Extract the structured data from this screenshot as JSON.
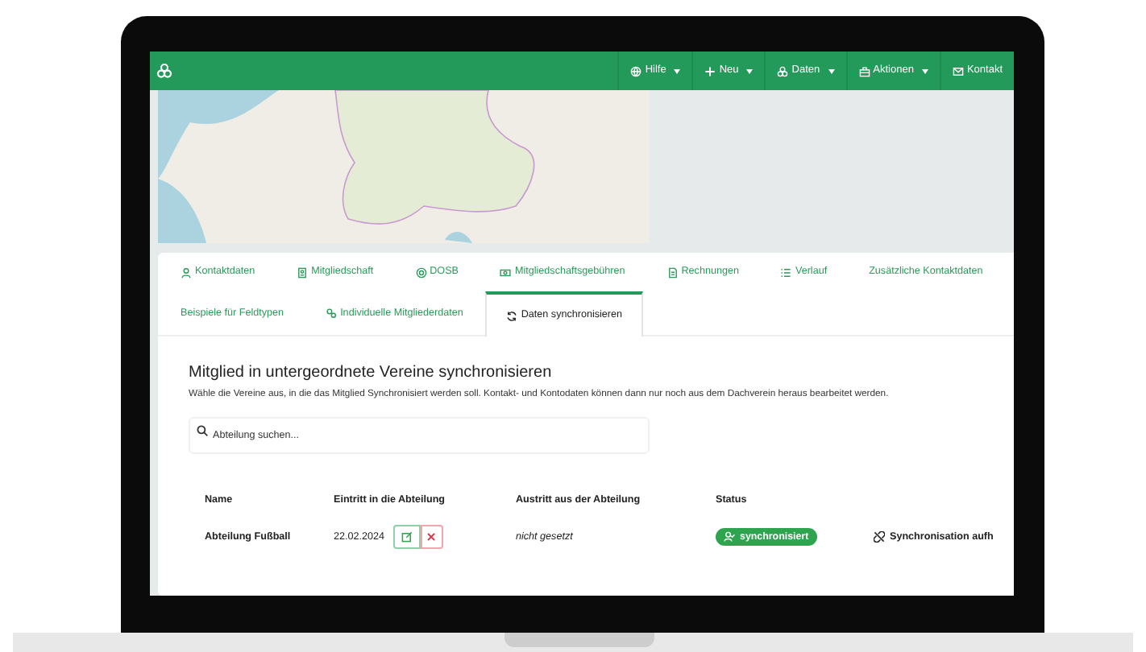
{
  "navbar": {
    "items": [
      {
        "label": "Hilfe"
      },
      {
        "label": "Neu"
      },
      {
        "label": "Daten"
      },
      {
        "label": "Aktionen"
      },
      {
        "label": "Kontakt"
      }
    ]
  },
  "tabs": [
    {
      "label": "Kontaktdaten",
      "selected": false
    },
    {
      "label": "Mitgliedschaft",
      "selected": false
    },
    {
      "label": "DOSB",
      "selected": false
    },
    {
      "label": "Mitgliedschaftsgebühren",
      "selected": false
    },
    {
      "label": "Rechnungen",
      "selected": false
    },
    {
      "label": "Verlauf",
      "selected": false
    },
    {
      "label": "Zusätzliche Kontaktdaten",
      "selected": false
    },
    {
      "label": "Beispiele für Feldtypen",
      "selected": false
    },
    {
      "label": "Individuelle Mitgliederdaten",
      "selected": false
    },
    {
      "label": "Daten synchronisieren",
      "selected": true
    }
  ],
  "section": {
    "title": "Mitglied in untergeordnete Vereine synchronisieren",
    "description": "Wähle die Vereine aus, in die das Mitglied Synchronisiert werden soll. Kontakt- und Kontodaten können dann nur noch aus dem Dachverein heraus bearbeitet werden.",
    "search": {
      "placeholder": "Abteilung suchen..."
    }
  },
  "table": {
    "columns": [
      "Name",
      "Eintritt in die Abteilung",
      "Austritt aus der Abteilung",
      "Status"
    ],
    "rows": [
      {
        "name": "Abteilung Fußball",
        "entry": "22.02.2024",
        "exit": "nicht gesetzt",
        "status": "synchronisiert",
        "action": "Synchronisation aufh"
      }
    ]
  }
}
